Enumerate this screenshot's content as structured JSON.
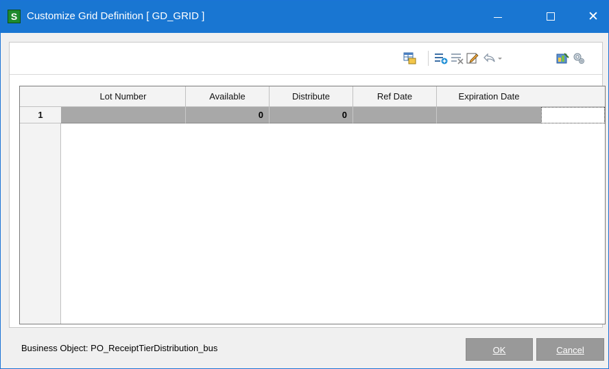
{
  "window": {
    "title": "Customize Grid Definition [ GD_GRID ]",
    "app_icon_letter": "S",
    "accent_color": "#1976d2"
  },
  "toolbar": {
    "icons": [
      "grid-properties-icon",
      "add-column-icon",
      "delete-column-icon",
      "edit-icon",
      "undo-icon",
      "dropdown-arrow-icon",
      "customize-icon",
      "settings-icon"
    ]
  },
  "grid": {
    "row_header": "",
    "columns": [
      "Lot Number",
      "Available",
      "Distribute",
      "Ref Date",
      "Expiration Date"
    ],
    "rows": [
      {
        "num": "1",
        "cells": [
          "",
          "0",
          "0",
          "",
          ""
        ]
      }
    ]
  },
  "status": {
    "business_object": "Business Object: PO_ReceiptTierDistribution_bus"
  },
  "buttons": {
    "ok_label": "OK",
    "cancel_label": "Cancel"
  }
}
